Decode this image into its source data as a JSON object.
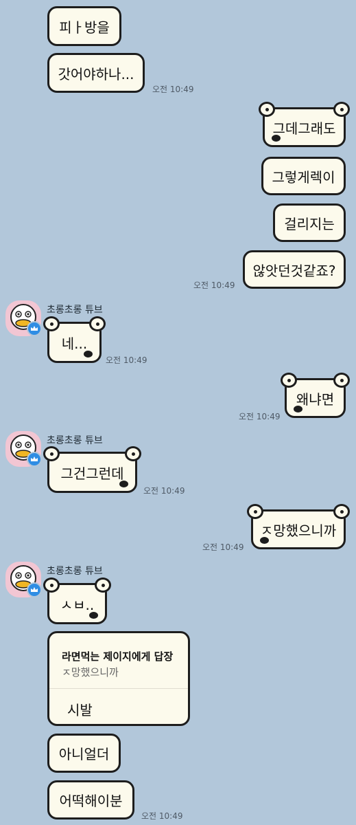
{
  "messages": {
    "m1": "피ㅏ방을",
    "m2": "갓어야하나...",
    "m3": "그데그래도",
    "m4": "그렇게렉이",
    "m5": "걸리지는",
    "m6": "않앗던것같죠?",
    "m7": "네...",
    "m8": "왜냐면",
    "m9": "그건그런데",
    "m10": "ㅈ망했으니까",
    "m11": "ㅅㅂ..",
    "m12": "아니얼더",
    "m13": "어떡해이분"
  },
  "reply": {
    "header": "라면먹는 제이지에게 답장",
    "quote": "ㅈ망했으니까",
    "text": "시발"
  },
  "sender": {
    "name": "초롱초롱 튜브"
  },
  "times": {
    "t": "오전 10:49"
  },
  "colors": {
    "background": "#b2c7da",
    "bubble": "#fcfaec",
    "badge": "#2f8de4"
  }
}
